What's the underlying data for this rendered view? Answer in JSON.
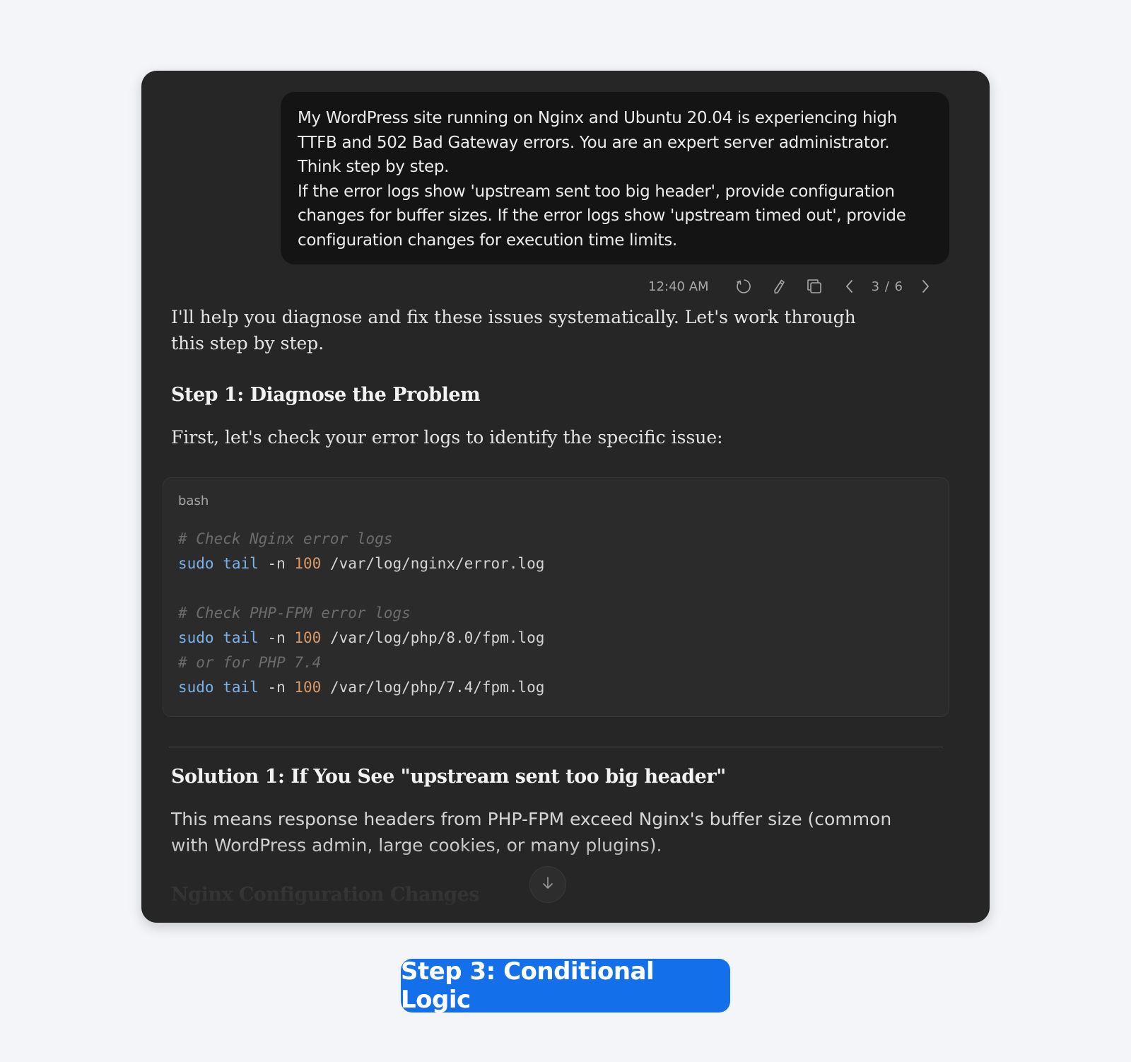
{
  "user_message": {
    "paragraphs": [
      "My WordPress site running on Nginx and Ubuntu 20.04 is experiencing high TTFB and 502 Bad Gateway errors. You are an expert server administrator. Think step by step.",
      "If the error logs show 'upstream sent too big header', provide configuration changes for buffer sizes. If the error logs show 'upstream timed out', provide configuration changes for execution time limits."
    ],
    "timestamp": "12:40 AM",
    "actions": {
      "retry_icon": "refresh-icon",
      "edit_icon": "pencil-icon",
      "copy_icon": "copy-icon"
    },
    "pager": {
      "label": "3 / 6",
      "current": 3,
      "total": 6
    }
  },
  "assistant_message": {
    "intro": "I'll help you diagnose and fix these issues systematically. Let's work through this step by step.",
    "step1_heading": "Step 1: Diagnose the Problem",
    "step1_text": "First, let's check your error logs to identify the specific issue:",
    "code": {
      "language": "bash",
      "lines": [
        {
          "comment": "# Check Nginx error logs"
        },
        {
          "cmd": "sudo tail",
          "flag": " -n ",
          "num": "100",
          "arg": " /var/log/nginx/error.log"
        },
        {
          "blank": true
        },
        {
          "comment": "# Check PHP-FPM error logs"
        },
        {
          "cmd": "sudo tail",
          "flag": " -n ",
          "num": "100",
          "arg": " /var/log/php/8.0/fpm.log"
        },
        {
          "comment": "# or for PHP 7.4"
        },
        {
          "cmd": "sudo tail",
          "flag": " -n ",
          "num": "100",
          "arg": " /var/log/php/7.4/fpm.log"
        }
      ]
    },
    "solution1_heading": "Solution 1: If You See \"upstream sent too big header\"",
    "solution1_text": "This means response headers from PHP-FPM exceed Nginx's buffer size (common with WordPress admin, large cookies, or many plugins).",
    "next_heading": "Nginx Configuration Changes"
  },
  "scroll_button_icon": "arrow-down-icon",
  "badge": {
    "label": "Step 3: Conditional Logic",
    "color": "#1470ea"
  },
  "colors": {
    "background": "#f3f5f8",
    "card": "#262626",
    "user_bubble": "#141414",
    "code_command": "#7cb1e6",
    "code_number": "#d79a6a",
    "code_comment": "#6c6c6c"
  }
}
